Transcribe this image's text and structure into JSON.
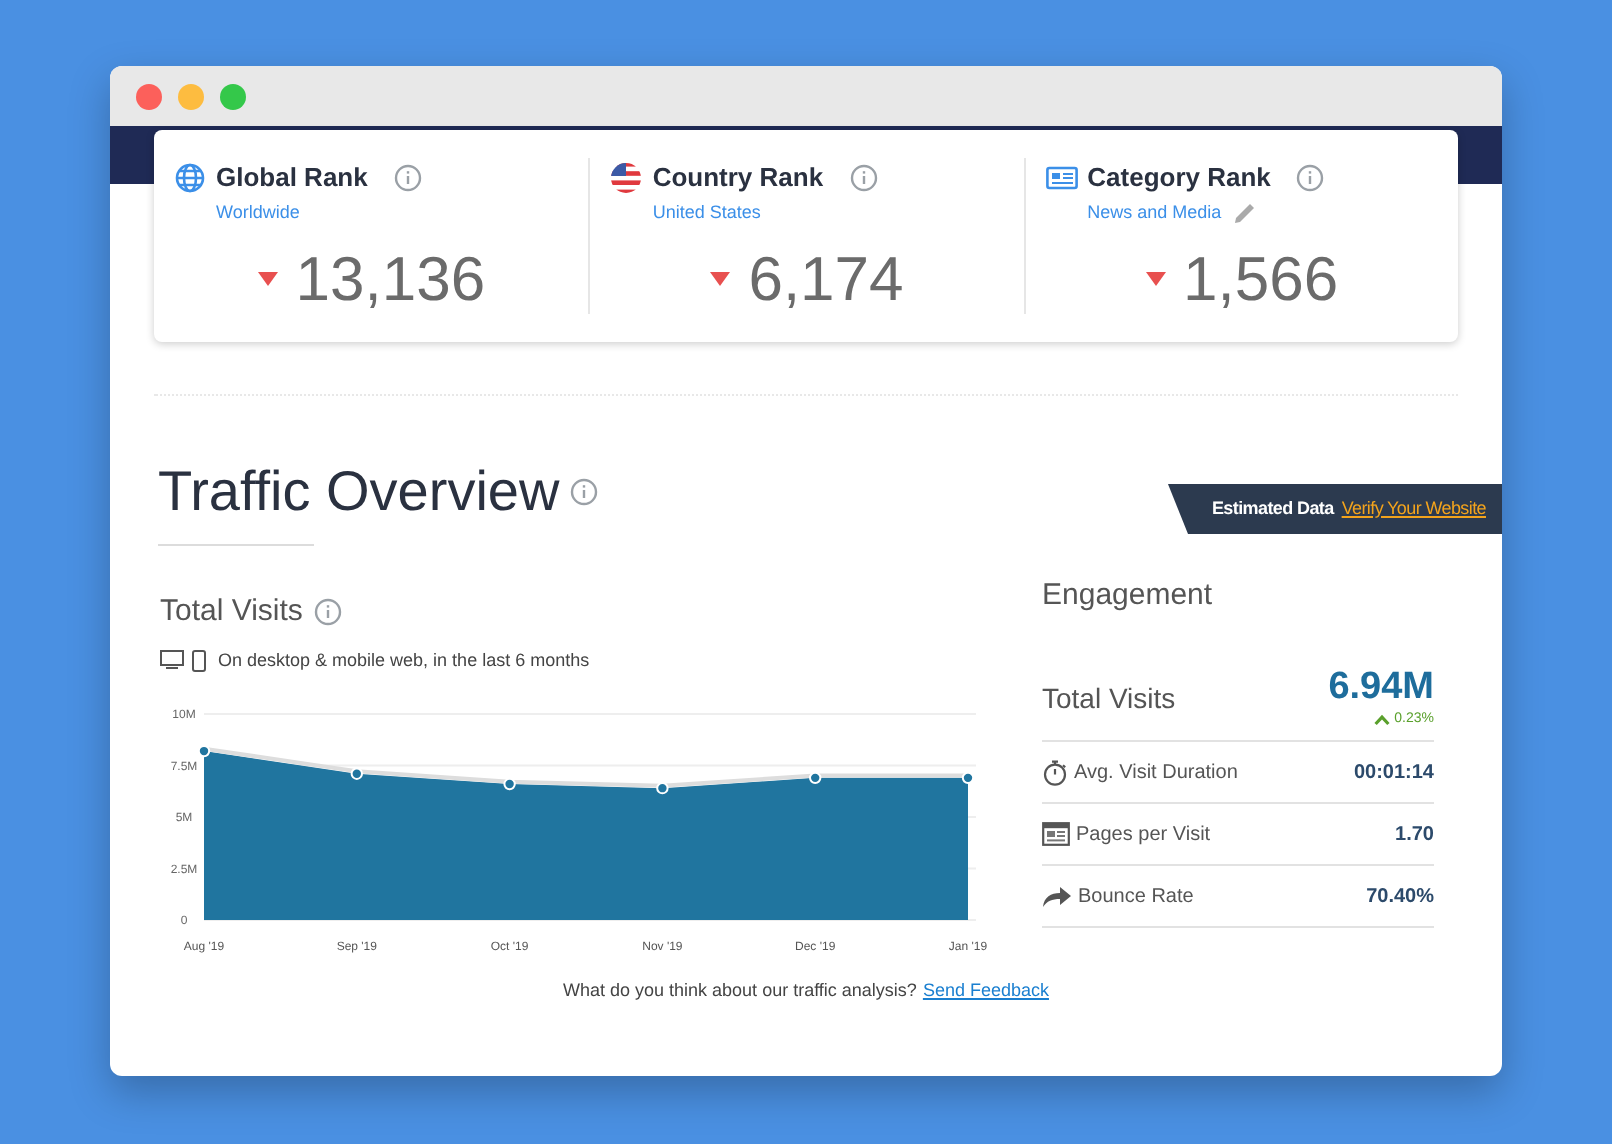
{
  "ranks": [
    {
      "kind": "globe",
      "title": "Global Rank",
      "subtitle": "Worldwide",
      "editable": false,
      "falling": true,
      "value": "13,136"
    },
    {
      "kind": "flag",
      "title": "Country Rank",
      "subtitle": "United States",
      "editable": false,
      "falling": true,
      "value": "6,174"
    },
    {
      "kind": "category",
      "title": "Category Rank",
      "subtitle": "News and Media",
      "editable": true,
      "falling": true,
      "value": "1,566"
    }
  ],
  "overview": {
    "title": "Traffic Overview",
    "badge": {
      "label": "Estimated Data",
      "link": "Verify Your Website"
    }
  },
  "total_visits": {
    "title": "Total Visits",
    "note": "On desktop & mobile web, in the last 6 months",
    "chart_data": {
      "type": "area",
      "categories": [
        "Aug '19",
        "Sep '19",
        "Oct '19",
        "Nov '19",
        "Dec '19",
        "Jan '19"
      ],
      "grid": true,
      "series": [
        {
          "color": "#20759f",
          "values": [
            8200000,
            7100000,
            6600000,
            6400000,
            6900000,
            6900000
          ]
        }
      ],
      "ylim": [
        0,
        10000000
      ],
      "yticks": [
        {
          "value": 0,
          "label": "0"
        },
        {
          "value": 2500000,
          "label": "2.5M"
        },
        {
          "value": 5000000,
          "label": "5M"
        },
        {
          "value": 7500000,
          "label": "7.5M"
        },
        {
          "value": 10000000,
          "label": "10M"
        }
      ]
    }
  },
  "engagement": {
    "title": "Engagement",
    "total": {
      "label": "Total Visits",
      "value": "6.94M",
      "change": "0.23%",
      "rising": true
    },
    "metrics": [
      {
        "kind": "timer",
        "label": "Avg. Visit Duration",
        "value": "00:01:14"
      },
      {
        "kind": "pages",
        "label": "Pages per Visit",
        "value": "1.70"
      },
      {
        "kind": "bounce",
        "label": "Bounce Rate",
        "value": "70.40%"
      }
    ]
  },
  "footer": {
    "text": "What do you think about our traffic analysis?",
    "link": "Send Feedback"
  }
}
